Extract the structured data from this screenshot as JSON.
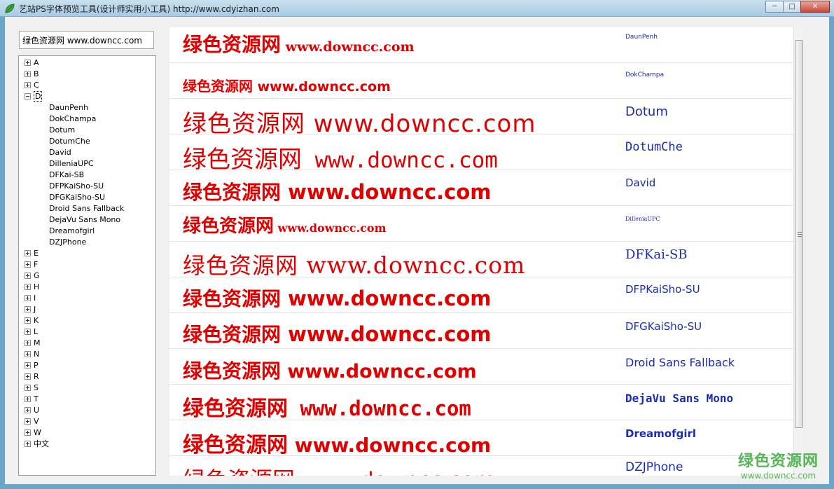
{
  "window": {
    "title": "艺站PS字体预览工具(设计师实用小工具) http://www.cdyizhan.com",
    "minimize": "─",
    "maximize": "□",
    "close": "✕"
  },
  "search": {
    "value": "绿色资源网 www.downcc.com"
  },
  "tree": {
    "before": [
      "A",
      "B",
      "C"
    ],
    "expanded": "D",
    "children": [
      "DaunPenh",
      "DokChampa",
      "Dotum",
      "DotumChe",
      "David",
      "DilleniaUPC",
      "DFKai-SB",
      "DFPKaiSho-SU",
      "DFGKaiSho-SU",
      "Droid Sans Fallback",
      "DejaVu Sans Mono",
      "Dreamofgirl",
      "DZJPhone"
    ],
    "after": [
      "E",
      "F",
      "G",
      "H",
      "I",
      "J",
      "K",
      "L",
      "M",
      "N",
      "P",
      "R",
      "S",
      "T",
      "U",
      "V",
      "W",
      "中文"
    ]
  },
  "preview": {
    "sample_text": "绿色资源网 www.downcc.com",
    "rows": [
      {
        "font": "DaunPenh"
      },
      {
        "font": "DokChampa"
      },
      {
        "font": "Dotum"
      },
      {
        "font": "DotumChe"
      },
      {
        "font": "David"
      },
      {
        "font": "DilleniaUPC"
      },
      {
        "font": "DFKai-SB"
      },
      {
        "font": "DFPKaiSho-SU"
      },
      {
        "font": "DFGKaiSho-SU"
      },
      {
        "font": "Droid Sans Fallback"
      },
      {
        "font": "DejaVu Sans Mono"
      },
      {
        "font": "Dreamofgirl"
      },
      {
        "font": "DZJPhone"
      }
    ]
  },
  "watermark": {
    "name": "绿色资源网",
    "url": "www.downcc.com"
  },
  "colors": {
    "sample": "#e00000",
    "font_name": "#1a2cb0",
    "watermark": "#3aaa3a"
  }
}
